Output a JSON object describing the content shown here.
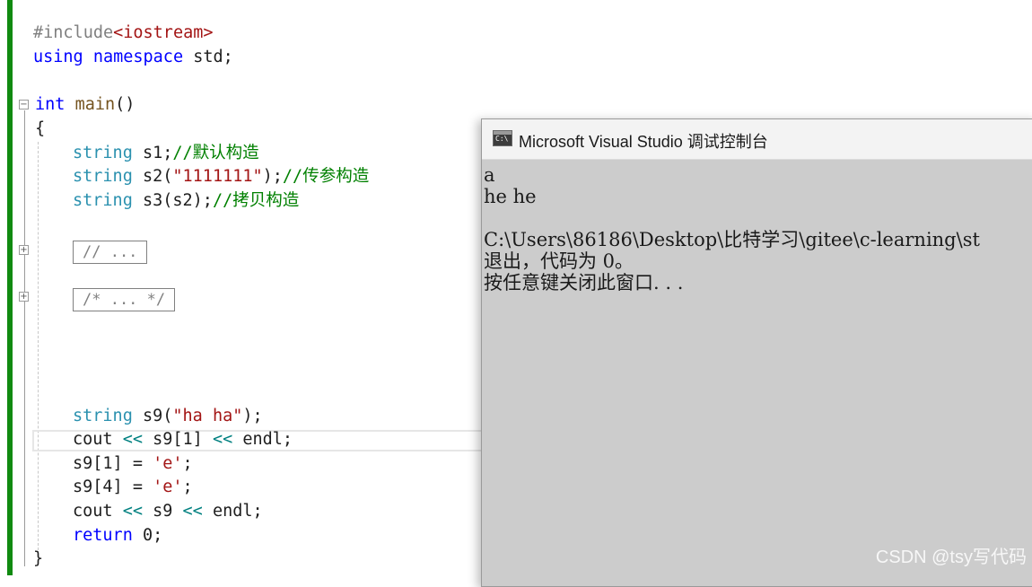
{
  "editor": {
    "line1": {
      "directive": "#include",
      "lt": "<",
      "header": "iostream",
      "gt": ">"
    },
    "line2": {
      "kw1": "using",
      "kw2": "namespace",
      "rest": " std;"
    },
    "line3": {
      "kw": "int",
      "fn": "main",
      "rest": "()"
    },
    "open_brace": "{",
    "line_s1": {
      "type": "string",
      "var": " s1;",
      "comment": "//默认构造"
    },
    "line_s2": {
      "type": "string",
      "pre": " s2(",
      "str": "\"1111111\"",
      "post": ");",
      "comment": "//传参构造"
    },
    "line_s3": {
      "type": "string",
      "pre": " s3(s2);",
      "comment": "//拷贝构造"
    },
    "collapsed1": "// ...",
    "collapsed2": "/* ... */",
    "line_s9": {
      "type": "string",
      "pre": " s9(",
      "str": "\"ha ha\"",
      "post": ");"
    },
    "line_cout1": {
      "pre": "cout ",
      "op1": "<<",
      "mid": " s9[1] ",
      "op2": "<<",
      "post": " endl;"
    },
    "line_assign1": {
      "pre": "s9[1] = ",
      "str": "'e'",
      "post": ";"
    },
    "line_assign2": {
      "pre": "s9[4] = ",
      "str": "'e'",
      "post": ";"
    },
    "line_cout2": {
      "pre": "cout ",
      "op1": "<<",
      "mid": " s9 ",
      "op2": "<<",
      "post": " endl;"
    },
    "line_return": {
      "kw": "return",
      "post": " 0;"
    },
    "close_brace": "}"
  },
  "console": {
    "title": "Microsoft Visual Studio 调试控制台",
    "icon_text": "C:\\",
    "lines": [
      "a",
      "he he",
      "",
      "C:\\Users\\86186\\Desktop\\比特学习\\gitee\\c-learning\\st",
      "退出，代码为 0。",
      "按任意键关闭此窗口. . ."
    ]
  },
  "watermark": "CSDN @tsy写代码",
  "colors": {
    "keyword": "#0000ff",
    "type": "#2b91af",
    "string": "#a31515",
    "comment": "#008000",
    "change_bar": "#108a10",
    "console_bg": "#cccccc"
  }
}
